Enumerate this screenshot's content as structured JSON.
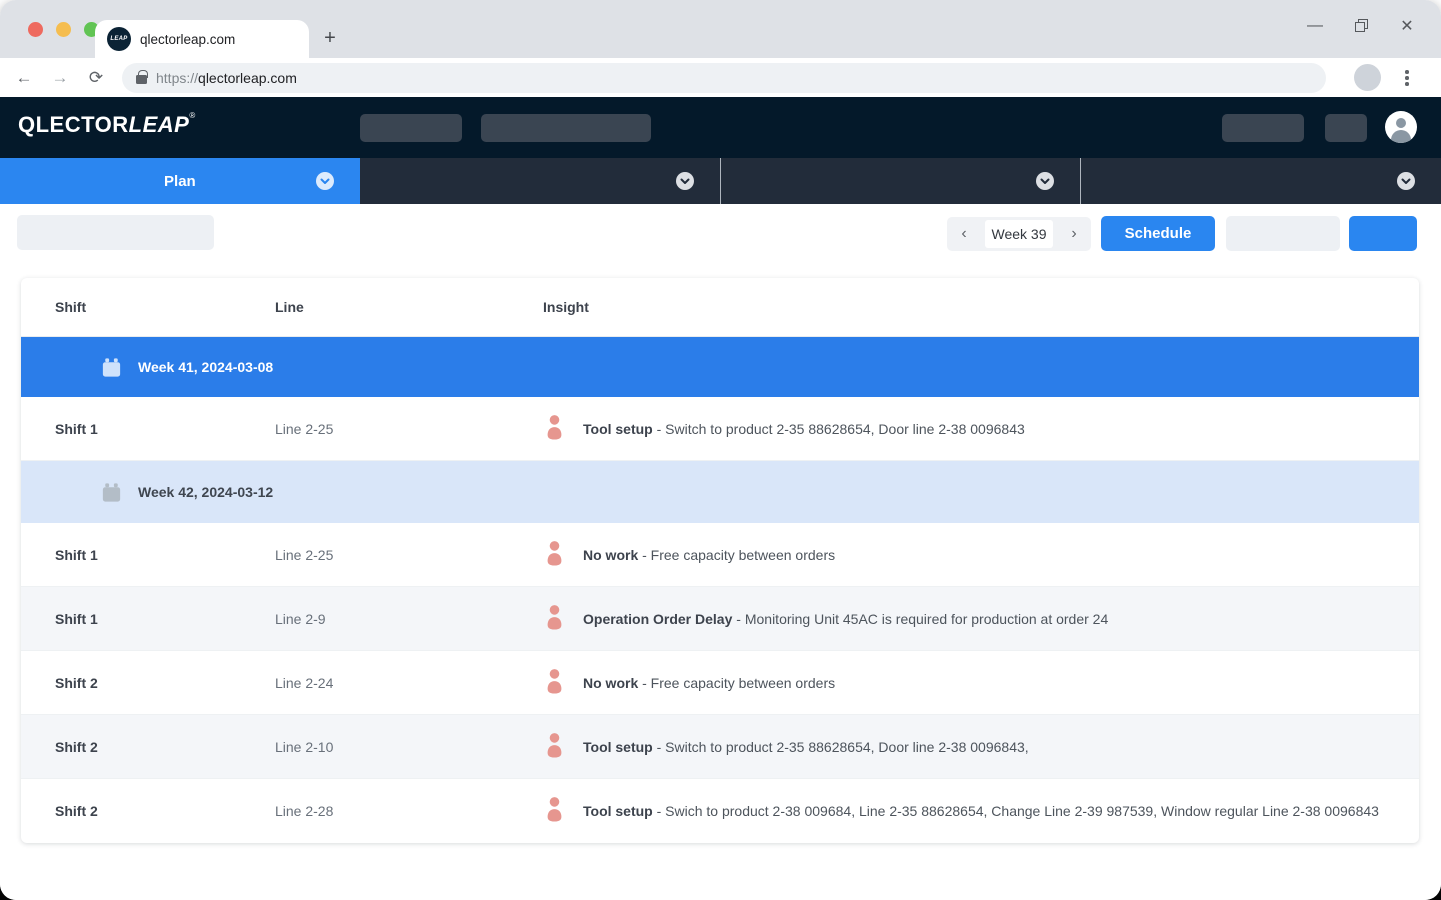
{
  "browser": {
    "tab_title": "qlectorleap.com",
    "favicon_text": "LEAP",
    "url_scheme": "https://",
    "url_host": "qlectorleap.com"
  },
  "icons": {
    "back": "←",
    "forward": "→",
    "reload": "⟳",
    "new_tab": "+",
    "minimize": "—",
    "close": "✕",
    "prev": "‹",
    "next": "›"
  },
  "header": {
    "logo_primary": "QLECTOR",
    "logo_secondary": "LEAP",
    "logo_reg": "®"
  },
  "nav": {
    "tabs": [
      {
        "label": "Plan",
        "active": true
      },
      {
        "label": "",
        "active": false
      },
      {
        "label": "",
        "active": false
      },
      {
        "label": "",
        "active": false
      }
    ]
  },
  "toolbar": {
    "week_label": "Week 39",
    "schedule_label": "Schedule"
  },
  "table": {
    "columns": [
      "Shift",
      "Line",
      "Insight"
    ],
    "rows": [
      {
        "type": "week",
        "style": "active",
        "label": "Week 41, 2024-03-08"
      },
      {
        "type": "data",
        "shift": "Shift 1",
        "line": "Line 2-25",
        "insight_title": "Tool setup",
        "insight_text": " - Switch to product 2-35 88628654, Door line 2-38 0096843"
      },
      {
        "type": "week",
        "style": "upcoming",
        "label": "Week 42, 2024-03-12"
      },
      {
        "type": "data",
        "shift": "Shift 1",
        "line": "Line 2-25",
        "insight_title": "No work",
        "insight_text": " - Free capacity between orders"
      },
      {
        "type": "data",
        "shift": "Shift 1",
        "line": "Line 2-9",
        "insight_title": "Operation Order Delay",
        "insight_text": " - Monitoring Unit 45AC is required for production at order 24"
      },
      {
        "type": "data",
        "shift": "Shift 2",
        "line": "Line 2-24",
        "insight_title": "No work",
        "insight_text": " - Free capacity between orders"
      },
      {
        "type": "data",
        "shift": "Shift 2",
        "line": "Line 2-10",
        "insight_title": "Tool setup",
        "insight_text": " - Switch to product 2-35 88628654, Door line 2-38 0096843,"
      },
      {
        "type": "data",
        "shift": "Shift 2",
        "line": "Line 2-28",
        "insight_title": "Tool setup",
        "insight_text": " - Swich to product 2-38 009684, Line 2-35 88628654, Change Line 2-39 987539, Window regular Line 2-38 0096843"
      }
    ]
  },
  "colors": {
    "accent_blue": "#2a86f0",
    "header_navy": "#04192a",
    "tab_dark": "#222c3a",
    "week_active_bg": "#2b7de9",
    "week_upcoming_bg": "#d9e6f9",
    "row_alt_bg": "#f4f6f9",
    "person_icon": "#e6968f"
  }
}
